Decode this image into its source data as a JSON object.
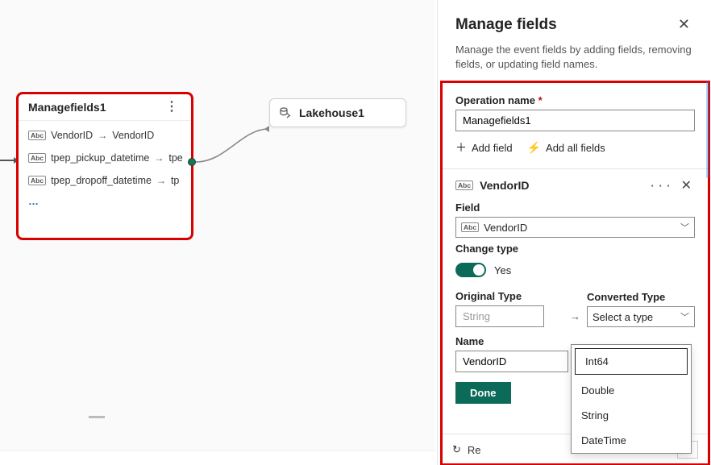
{
  "canvas": {
    "manageNode": {
      "title": "Managefields1",
      "rows": [
        {
          "from": "VendorID",
          "to": "VendorID"
        },
        {
          "from": "tpep_pickup_datetime",
          "to": "tpe"
        },
        {
          "from": "tpep_dropoff_datetime",
          "to": "tp"
        }
      ]
    },
    "lakeNode": {
      "title": "Lakehouse1"
    }
  },
  "panel": {
    "title": "Manage fields",
    "subtitle": "Manage the event fields by adding fields, removing fields, or updating field names.",
    "operationLabel": "Operation name",
    "operationValue": "Managefields1",
    "addField": "Add field",
    "addAllFields": "Add all fields",
    "field": {
      "icon": "Abc",
      "name": "VendorID",
      "fieldLabel": "Field",
      "fieldValue": "VendorID",
      "changeTypeLabel": "Change type",
      "toggleText": "Yes",
      "originalTypeLabel": "Original Type",
      "originalTypeValue": "String",
      "convertedTypeLabel": "Converted Type",
      "convertedTypePlaceholder": "Select a type",
      "nameLabel": "Name",
      "nameValue": "VendorID",
      "doneLabel": "Done",
      "typeOptions": [
        "Int64",
        "Double",
        "String",
        "DateTime"
      ]
    },
    "refreshLabel": "Re",
    "expandChevron": "⌃"
  }
}
